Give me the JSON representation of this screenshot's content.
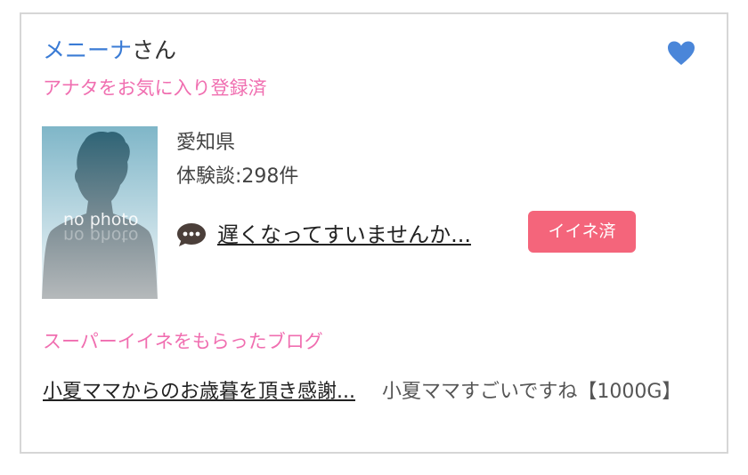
{
  "member": {
    "name": "メニーナ",
    "honorific": "さん",
    "favorite_note": "アナタをお気に入り登録済",
    "prefecture": "愛知県",
    "reviews": "体験談:298件",
    "photo_placeholder": "no photo",
    "heart_icon": "heart-icon",
    "heart_color": "#4a86d9"
  },
  "comment": {
    "icon": "speech-bubble-icon",
    "text": "遅くなってすいませんか...",
    "badge": "イイネ済",
    "badge_color": "#f4657b"
  },
  "blog": {
    "section_title": "スーパーイイネをもらったブログ",
    "title": "小夏ママからのお歳暮を頂き感謝...",
    "excerpt": "小夏ママすごいですね【1000G】"
  },
  "colors": {
    "accent_pink": "#f06eb0",
    "link_blue": "#3a7bd5"
  }
}
